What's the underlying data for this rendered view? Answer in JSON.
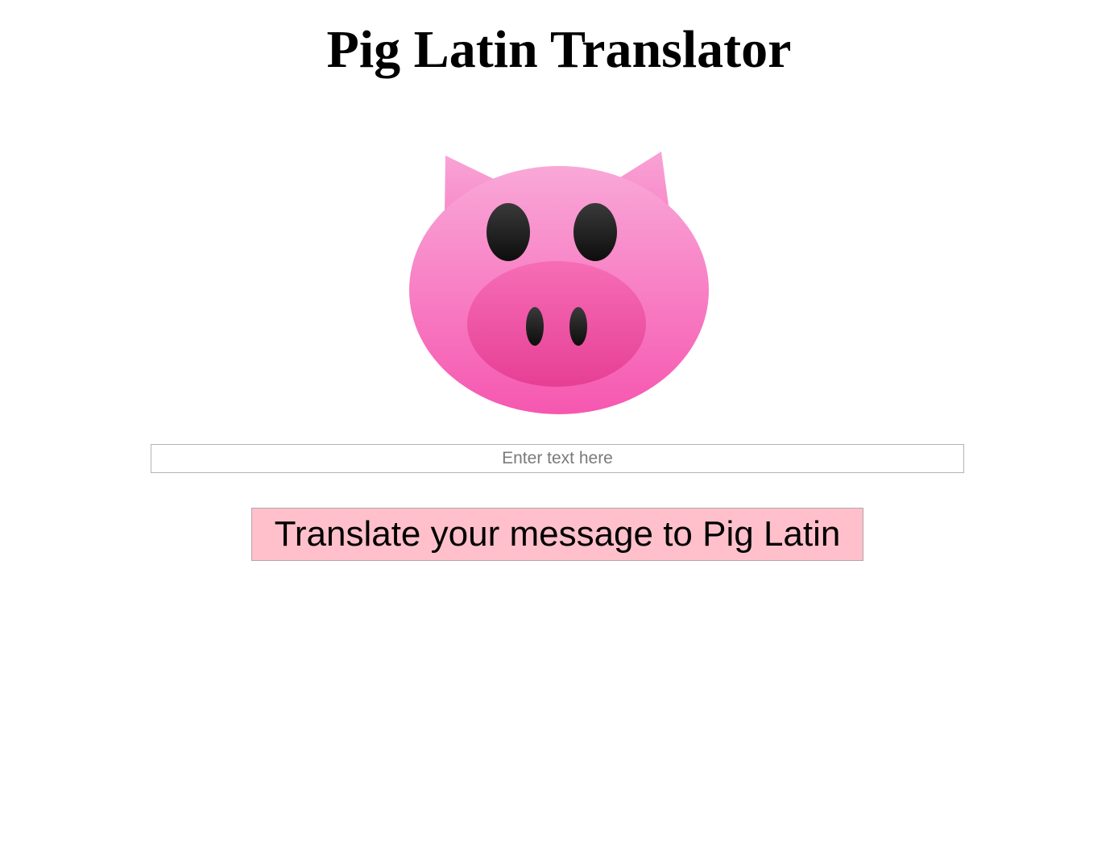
{
  "page": {
    "title": "Pig Latin Translator"
  },
  "logo": {
    "icon": "pig-face-icon",
    "colors": {
      "face_light": "#f9a8d8",
      "face_dark": "#f657b0",
      "snout_light": "#f66db5",
      "snout_dark": "#e63f95",
      "eyes": "#1a1a1a"
    }
  },
  "input": {
    "value": "",
    "placeholder": "Enter text here"
  },
  "button": {
    "label": "Translate your message to Pig Latin",
    "background": "#ffc0cb"
  }
}
